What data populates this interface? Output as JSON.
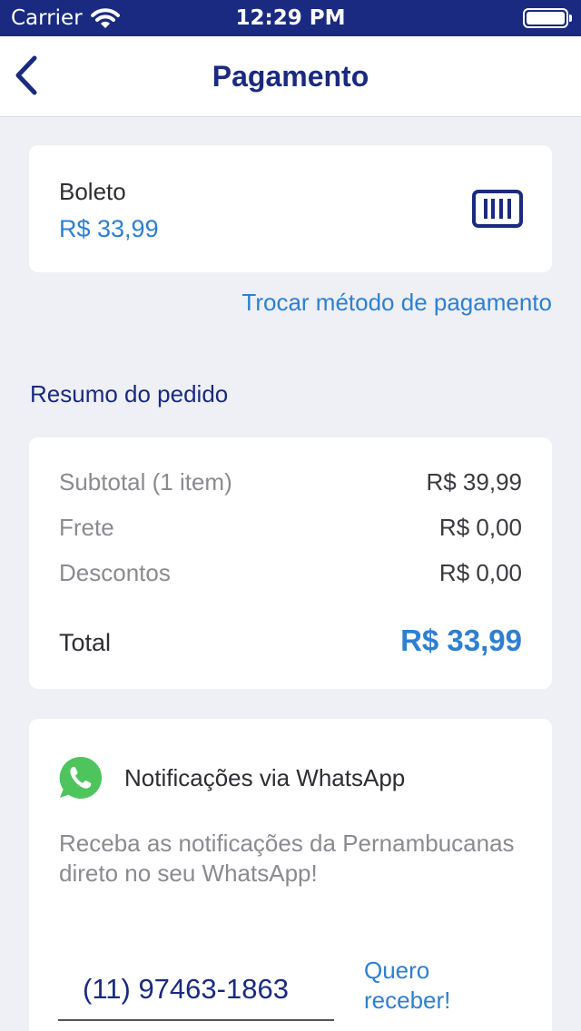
{
  "status_bar": {
    "carrier": "Carrier",
    "time": "12:29 PM"
  },
  "nav": {
    "title": "Pagamento"
  },
  "payment": {
    "method": "Boleto",
    "amount": "R$ 33,99",
    "change_label": "Trocar método de pagamento"
  },
  "summary": {
    "title": "Resumo do pedido",
    "rows": [
      {
        "label": "Subtotal (1 item)",
        "value": "R$ 39,99"
      },
      {
        "label": "Frete",
        "value": "R$ 0,00"
      },
      {
        "label": "Descontos",
        "value": "R$ 0,00"
      }
    ],
    "total_label": "Total",
    "total_value": "R$ 33,99"
  },
  "whatsapp": {
    "title": "Notificações via WhatsApp",
    "description": "Receba as notificações da Pernambucanas direto no seu WhatsApp!",
    "phone": "(11) 97463-1863",
    "button_label": "Quero receber!"
  },
  "colors": {
    "primary": "#1a2a80",
    "accent": "#2e7fd1",
    "whatsapp": "#4ec45d",
    "background": "#eef0f5"
  },
  "icons": [
    "wifi-icon",
    "battery-icon",
    "back-chevron-icon",
    "barcode-icon",
    "whatsapp-icon"
  ]
}
